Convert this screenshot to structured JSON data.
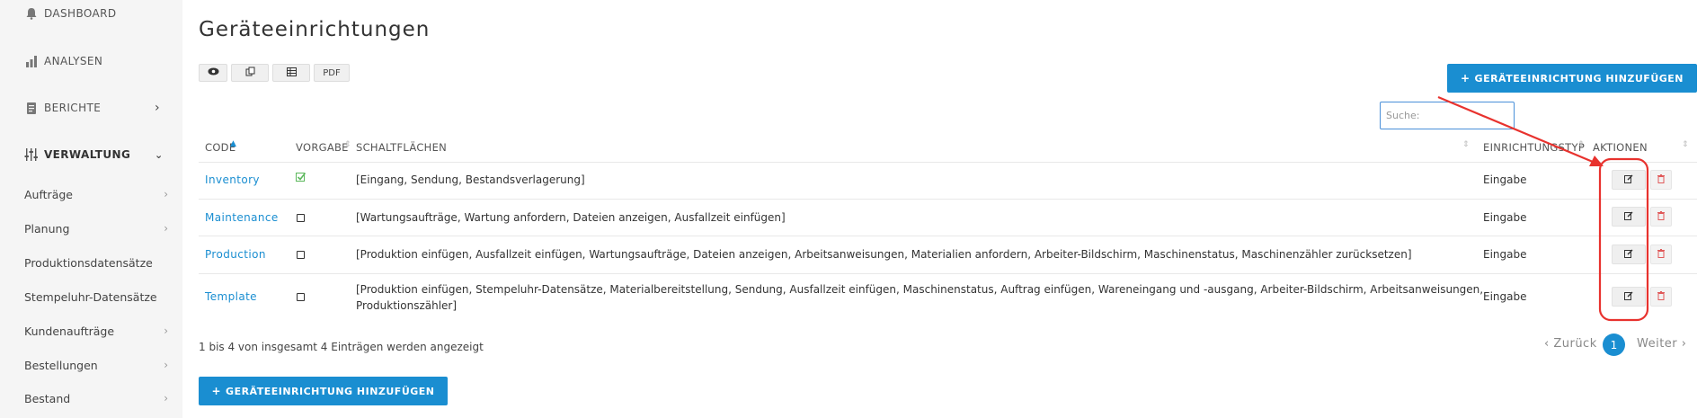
{
  "sidebar": {
    "dashboard": "DASHBOARD",
    "analysen": "ANALYSEN",
    "berichte": "BERICHTE",
    "verwaltung": "VERWALTUNG",
    "items": [
      "Aufträge",
      "Planung",
      "Produktionsdatensätze",
      "Stempeluhr-Datensätze",
      "Kundenaufträge",
      "Bestellungen",
      "Bestand"
    ]
  },
  "page": {
    "title": "Geräteeinrichtungen",
    "toolbar": {
      "pdf": "PDF"
    },
    "add_label": "GERÄTEEINRICHTUNG HINZUFÜGEN",
    "search_placeholder": "Suche:"
  },
  "table": {
    "headers": [
      "CODE",
      "VORGABE",
      "SCHALTFLÄCHEN",
      "EINRICHTUNGSTYP",
      "AKTIONEN"
    ],
    "rows": [
      {
        "code": "Inventory",
        "default": true,
        "buttons": "[Eingang, Sendung, Bestandsverlagerung]",
        "type": "Eingabe"
      },
      {
        "code": "Maintenance",
        "default": false,
        "buttons": "[Wartungsaufträge, Wartung anfordern, Dateien anzeigen, Ausfallzeit einfügen]",
        "type": "Eingabe"
      },
      {
        "code": "Production",
        "default": false,
        "buttons": "[Produktion einfügen, Ausfallzeit einfügen, Wartungsaufträge, Dateien anzeigen, Arbeitsanweisungen, Materialien anfordern, Arbeiter-Bildschirm, Maschinenstatus, Maschinenzähler zurücksetzen]",
        "type": "Eingabe"
      },
      {
        "code": "Template",
        "default": false,
        "buttons_line1": "[Produktion einfügen, Stempeluhr-Datensätze, Materialbereitstellung, Sendung, Ausfallzeit einfügen, Maschinenstatus, Auftrag einfügen, Wareneingang und -ausgang, Arbeiter-Bildschirm, Arbeitsanweisungen,",
        "buttons_line2": "Produktionszähler]",
        "type": "Eingabe"
      }
    ]
  },
  "footer": {
    "info": "1 bis 4 von insgesamt 4 Einträgen werden angezeigt",
    "prev": "‹ Zurück",
    "current": "1",
    "next": "Weiter ›"
  },
  "colors": {
    "accent": "#1a8ed1",
    "annotation": "#e8322e",
    "check": "#5cb85c",
    "delete": "#e05a5a"
  }
}
